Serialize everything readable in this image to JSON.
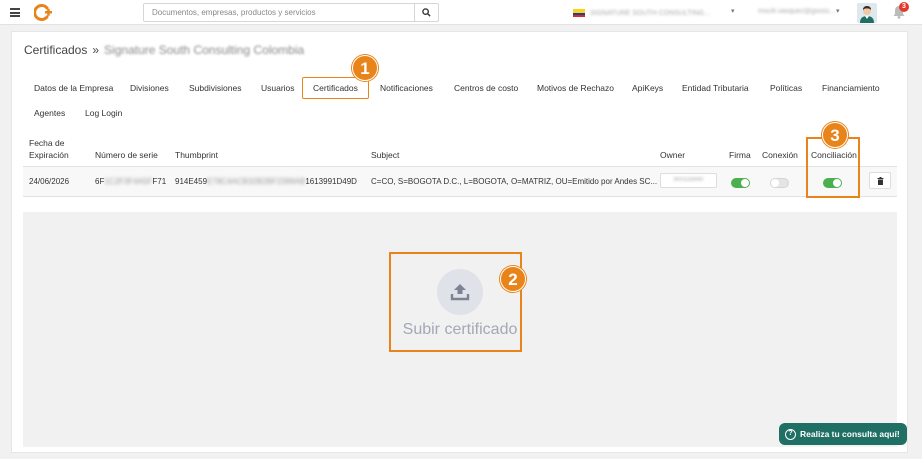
{
  "topbar": {
    "search_placeholder": "Documentos, empresas, productos y servicios",
    "company_name": "SIGNATURE SOUTH CONSULTING...",
    "user_email": "mscifi.vasquez@gsoss...",
    "notification_count": "3",
    "colors": {
      "flag_yellow": "#f7d51d",
      "flag_blue": "#1e3f9a",
      "flag_red": "#d8282a",
      "logo_orange": "#e8841a"
    }
  },
  "breadcrumb": {
    "section": "Certificados",
    "separator": "»",
    "company": "Signature South Consulting Colombia"
  },
  "tabs": [
    "Datos de la Empresa",
    "Divisiones",
    "Subdivisiones",
    "Usuarios",
    "Certificados",
    "Notificaciones",
    "Centros de costo",
    "Motivos de Rechazo",
    "ApiKeys",
    "Entidad Tributaria",
    "Políticas",
    "Financiamiento",
    "Agentes",
    "Log Login"
  ],
  "active_tab": "Certificados",
  "table": {
    "headers": {
      "expiration_line1": "Fecha de",
      "expiration_line2": "Expiración",
      "serial": "Número de serie",
      "thumbprint": "Thumbprint",
      "subject": "Subject",
      "owner": "Owner",
      "firma": "Firma",
      "conexion": "Conexión",
      "conciliacion": "Conciliación"
    },
    "rows": [
      {
        "expiration": "24/06/2026",
        "serial_start": "6F",
        "serial_hidden": "1C2F3F4A5F",
        "serial_end": "F71",
        "thumbprint_start": "914E459",
        "thumbprint_hidden": "E78C4ACB32B2BF2399AB",
        "thumbprint_end": "1613991D49D",
        "subject": "C=CO, S=BOGOTA D.C., L=BOGOTA, O=MATRIZ, OU=Emitido por Andes SC...",
        "owner": "900328990",
        "firma": true,
        "conexion": false,
        "conciliacion": true
      }
    ]
  },
  "upload": {
    "label": "Subir certificado"
  },
  "annotations": {
    "step1": "1",
    "step2": "2",
    "step3": "3",
    "color": "#e8841a"
  },
  "help_button": {
    "label": "Realiza tu consulta aquí!",
    "color": "#1f6f65"
  }
}
